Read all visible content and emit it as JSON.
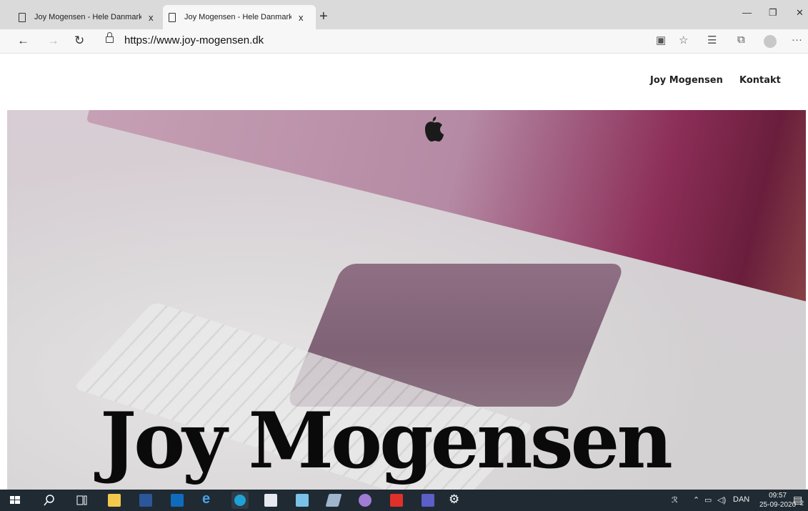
{
  "browser": {
    "tabs": [
      {
        "title": "Joy Mogensen - Hele Danmarks",
        "close": "x",
        "active": false
      },
      {
        "title": "Joy Mogensen - Hele Danmarks",
        "close": "x",
        "active": true
      }
    ],
    "new_tab_label": "+",
    "window_controls": {
      "minimize": "—",
      "restore": "❐",
      "close": "✕"
    },
    "nav": {
      "back": "←",
      "forward": "→",
      "refresh": "↻"
    },
    "url": "https://www.joy-mogensen.dk",
    "toolbar_icons": [
      "reader-view-icon",
      "favorite-star-icon",
      "favorites-list-icon",
      "collections-icon",
      "profile-avatar-icon",
      "more-menu-icon"
    ],
    "more_label": "···"
  },
  "site": {
    "nav": [
      {
        "label": "Joy Mogensen"
      },
      {
        "label": "Kontakt"
      }
    ],
    "hero": {
      "title": "Joy Mogensen"
    }
  },
  "taskbar": {
    "apps": [
      "start-icon",
      "search-icon",
      "task-view-icon",
      "file-explorer-icon",
      "word-icon",
      "outlook-icon",
      "internet-explorer-icon",
      "edge-icon",
      "app-icon",
      "app-icon-2",
      "app-icon-3",
      "app-icon-4",
      "acrobat-icon",
      "teams-icon",
      "settings-icon"
    ],
    "tray": {
      "language": "DAN",
      "time": "09:57",
      "date": "25-09-2020",
      "notifications": "2"
    },
    "colors": {
      "bar": "#1f2a33"
    }
  }
}
